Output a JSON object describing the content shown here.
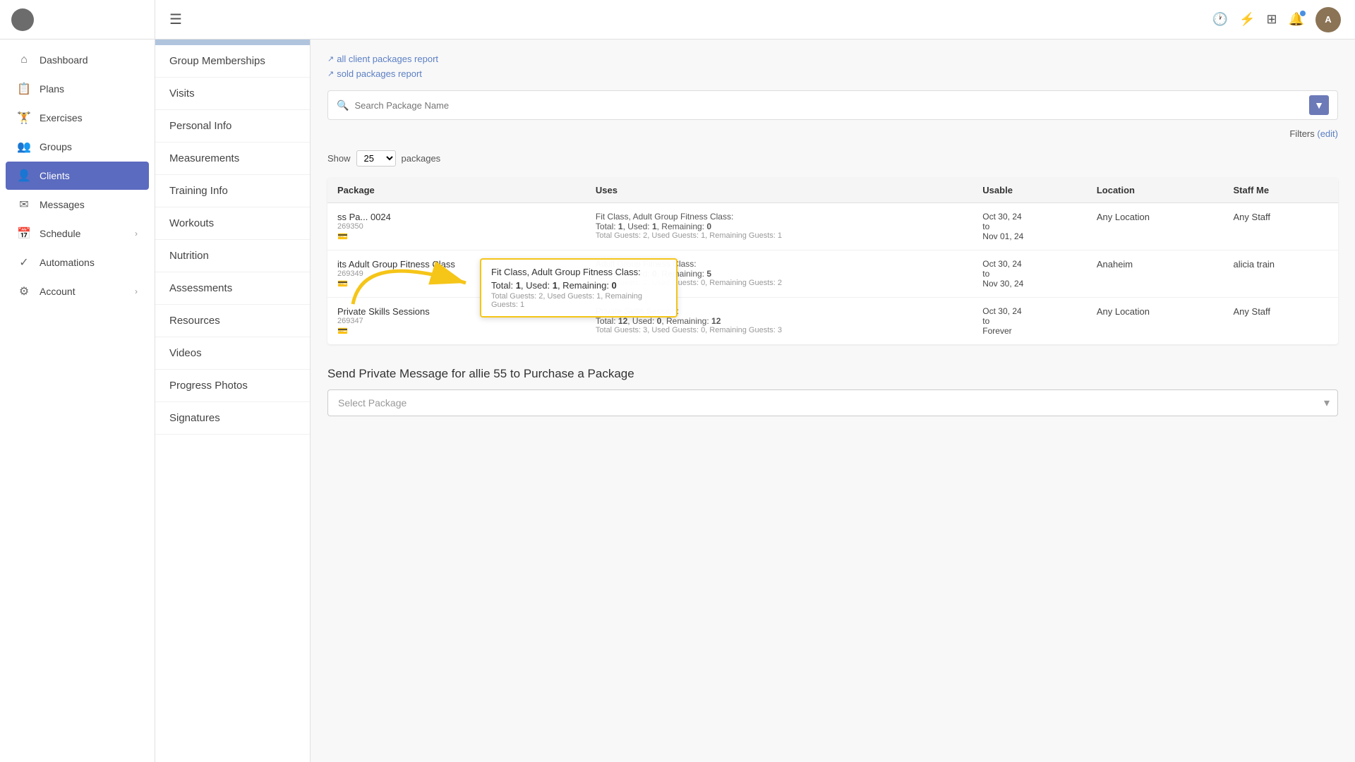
{
  "sidebar": {
    "items": [
      {
        "id": "dashboard",
        "label": "Dashboard",
        "icon": "⌂",
        "active": false
      },
      {
        "id": "plans",
        "label": "Plans",
        "icon": "📋",
        "active": false
      },
      {
        "id": "exercises",
        "label": "Exercises",
        "icon": "🏋",
        "active": false
      },
      {
        "id": "groups",
        "label": "Groups",
        "icon": "👥",
        "active": false
      },
      {
        "id": "clients",
        "label": "Clients",
        "icon": "👤",
        "active": true
      },
      {
        "id": "messages",
        "label": "Messages",
        "icon": "✉",
        "active": false
      },
      {
        "id": "schedule",
        "label": "Schedule",
        "icon": "📅",
        "active": false,
        "arrow": true
      },
      {
        "id": "automations",
        "label": "Automations",
        "icon": "✓",
        "active": false
      },
      {
        "id": "account",
        "label": "Account",
        "icon": "⚙",
        "active": false,
        "arrow": true
      }
    ]
  },
  "topbar": {
    "history_icon": "🕐",
    "lightning_icon": "⚡",
    "grid_icon": "⊞",
    "bell_icon": "🔔",
    "avatar_initials": "A"
  },
  "subnav": {
    "items": [
      "Group Memberships",
      "Visits",
      "Personal Info",
      "Measurements",
      "Training Info",
      "Workouts",
      "Nutrition",
      "Assessments",
      "Resources",
      "Videos",
      "Progress Photos",
      "Signatures"
    ]
  },
  "main": {
    "links": [
      {
        "label": "all client packages report",
        "icon": "↗"
      },
      {
        "label": "sold packages report",
        "icon": "↗"
      }
    ],
    "search_placeholder": "Search Package Name",
    "filters_label": "Filters",
    "filters_edit": "(edit)",
    "show_label": "Show",
    "show_value": "25",
    "packages_label": "packages",
    "table": {
      "columns": [
        "Package",
        "Uses",
        "Usable",
        "Location",
        "Staff Me"
      ],
      "rows": [
        {
          "pkg_name": "ss Pa... 0024",
          "pkg_id": "269350",
          "pkg_icon": true,
          "uses_label": "Fit Class, Adult Group Fitness Class:",
          "uses_total": "1",
          "uses_used": "1",
          "uses_remaining": "0",
          "uses_guests": "Total Guests: 2, Used Guests: 1, Remaining Guests: 1",
          "usable_from": "Oct 30, 24",
          "usable_to": "Nov 01, 24",
          "location": "Any Location",
          "staff": "Any Staff",
          "highlighted": true
        },
        {
          "pkg_name": "its Adult Group Fitness Class",
          "pkg_id": "269349",
          "pkg_icon": true,
          "uses_label": "Adult Group Fitness Class:",
          "uses_total": "5",
          "uses_used": "0",
          "uses_remaining": "5",
          "uses_guests": "Total Guests: 2, Used Guests: 0, Remaining Guests: 2",
          "usable_from": "Oct 30, 24",
          "usable_to": "Nov 30, 24",
          "location": "Anaheim",
          "staff": "alicia train",
          "highlighted": false
        },
        {
          "pkg_name": "Private Skills Sessions",
          "pkg_id": "269347",
          "pkg_icon": true,
          "uses_label": "Private Skills Session:",
          "uses_total": "12",
          "uses_used": "0",
          "uses_remaining": "12",
          "uses_guests": "Total Guests: 3, Used Guests: 0, Remaining Guests: 3",
          "usable_from": "Oct 30, 24",
          "usable_to": "Forever",
          "location": "Any Location",
          "staff": "Any Staff",
          "highlighted": false
        }
      ]
    },
    "send_message": {
      "title": "Send Private Message for allie 55 to Purchase a Package",
      "select_placeholder": "Select Package"
    },
    "highlight_box": {
      "pkg_name": "Fit Class, Adult Group Fitness Class:",
      "total": "1",
      "used": "1",
      "remaining": "0",
      "guests": "Total Guests: 2, Used Guests: 1, Remaining Guests: 1"
    }
  }
}
